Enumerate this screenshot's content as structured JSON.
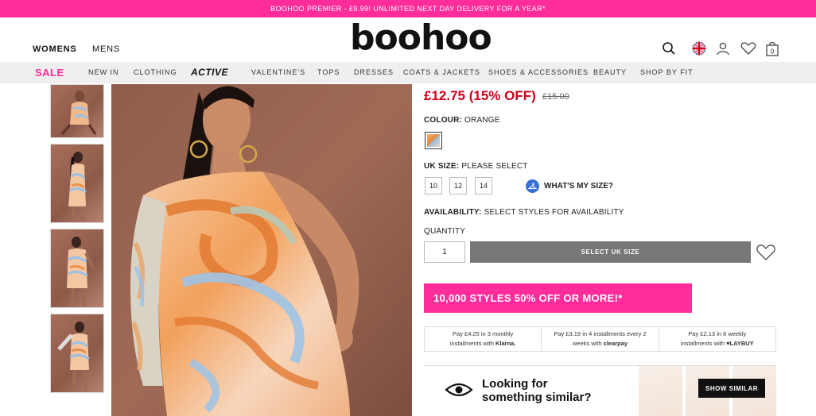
{
  "promo_bar": {
    "text": "BOOHOO PREMIER - £9.99! UNLIMITED NEXT DAY DELIVERY FOR A YEAR*"
  },
  "header": {
    "logo": "boohoo",
    "gender_links": [
      "WOMENS",
      "MENS"
    ],
    "basket_count": "0",
    "icons": [
      "search-icon",
      "uk-flag-icon",
      "account-icon",
      "wishlist-icon",
      "bag-icon"
    ]
  },
  "nav": {
    "items": [
      "SALE",
      "NEW IN",
      "CLOTHING",
      "ACTIVE",
      "VALENTINE'S",
      "TOPS",
      "DRESSES",
      "COATS & JACKETS",
      "SHOES & ACCESSORIES",
      "BEAUTY",
      "SHOP BY FIT"
    ]
  },
  "product": {
    "price_now": "£12.75 (15% OFF)",
    "price_was": "£15.00",
    "colour_label": "COLOUR:",
    "colour_value": "ORANGE",
    "size_label": "UK SIZE:",
    "size_value": "PLEASE SELECT",
    "sizes": [
      "10",
      "12",
      "14"
    ],
    "whats_my_size": "WHAT'S MY SIZE?",
    "availability_label": "AVAILABILITY:",
    "availability_value": "SELECT STYLES FOR AVAILABILITY",
    "quantity_label": "QUANTITY",
    "quantity_value": "1",
    "add_button": "SELECT UK SIZE"
  },
  "promo_banner": {
    "text": "10,000 STYLES 50% OFF OR MORE!*"
  },
  "payments": [
    {
      "line1": "Pay £4.25 in 3 monthly",
      "line2": "installments with",
      "brand": "Klarna."
    },
    {
      "line1": "Pay £3.19 in 4 installments every 2",
      "line2": "weeks with",
      "brand": "clearpay"
    },
    {
      "line1": "Pay £2.13 in 6 weekly",
      "line2": "installments with",
      "brand": "LAYBUY"
    }
  ],
  "similar": {
    "heading_line1": "Looking for",
    "heading_line2": "something similar?",
    "button": "SHOW SIMILAR"
  },
  "colors": {
    "brand_pink": "#ff2c9c",
    "sale_price": "#d0021b",
    "button_grey": "#777777"
  }
}
